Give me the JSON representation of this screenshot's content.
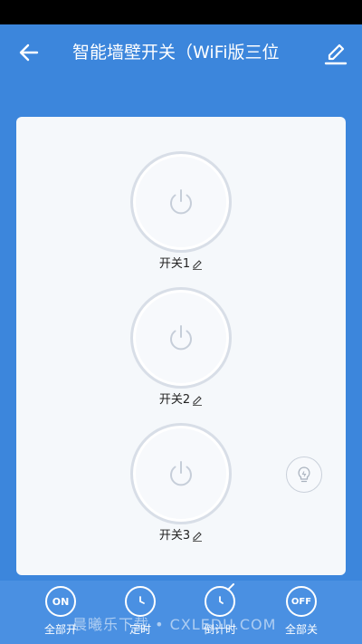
{
  "header": {
    "title": "智能墙壁开关（WiFi版三位",
    "back_icon": "arrow-left-icon",
    "edit_icon": "pencil-icon"
  },
  "switches": [
    {
      "label": "开关1",
      "state": "off"
    },
    {
      "label": "开关2",
      "state": "off"
    },
    {
      "label": "开关3",
      "state": "off"
    }
  ],
  "bulb_icon": "lightbulb-icon",
  "bottom_bar": {
    "all_on": {
      "icon_text": "ON",
      "label": "全部开"
    },
    "timer": {
      "label": "定时"
    },
    "countdown": {
      "label": "倒计时"
    },
    "all_off": {
      "icon_text": "OFF",
      "label": "全部关"
    }
  },
  "watermark": "晨曦乐下载 • CXLEDU.COM",
  "colors": {
    "header_bg": "#3c86dc",
    "card_bg": "#f5f8fb",
    "switch_ring": "#d8dee7",
    "bottom_bar_bg": "#4a90e2"
  }
}
